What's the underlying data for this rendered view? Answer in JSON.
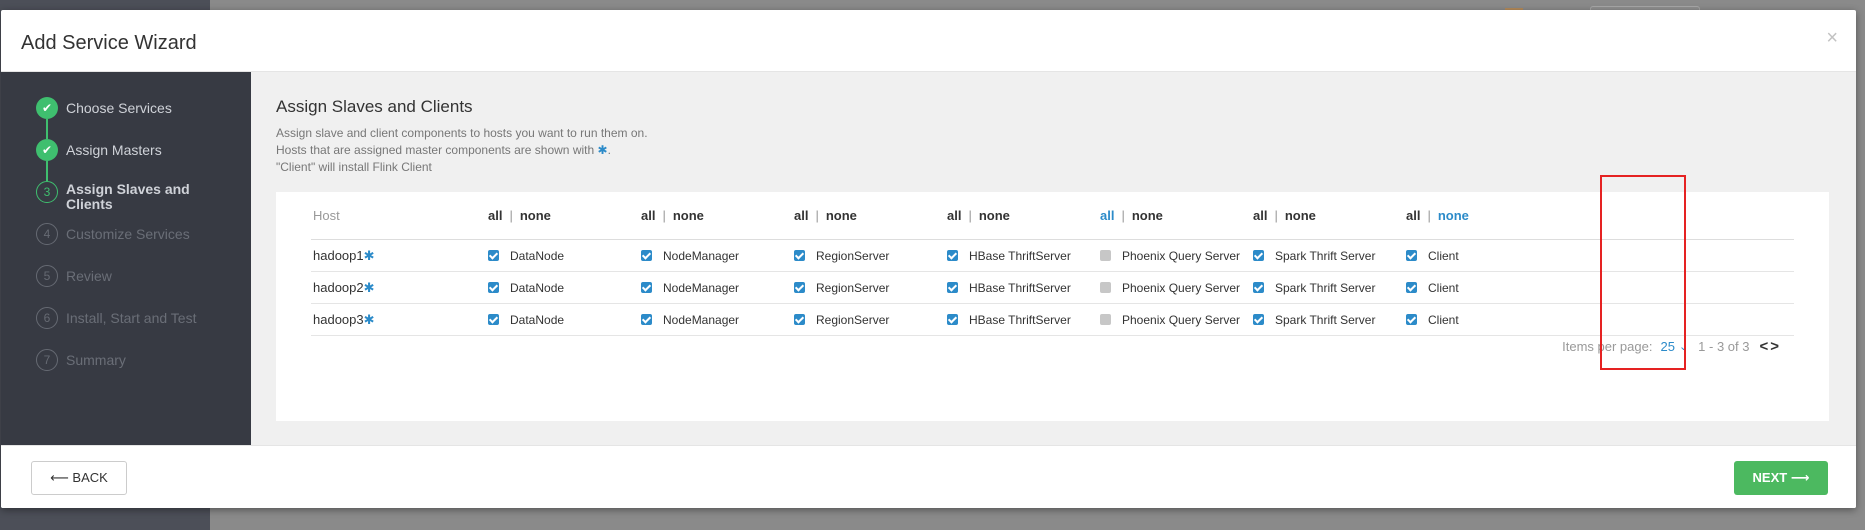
{
  "modal": {
    "title": "Add Service Wizard",
    "close_glyph": "×"
  },
  "steps": [
    {
      "icon": "✔",
      "label": "Choose Services",
      "state": "done"
    },
    {
      "icon": "✔",
      "label": "Assign Masters",
      "state": "done"
    },
    {
      "icon": "3",
      "label": "Assign Slaves and Clients",
      "state": "current"
    },
    {
      "icon": "4",
      "label": "Customize Services",
      "state": "todo"
    },
    {
      "icon": "5",
      "label": "Review",
      "state": "todo"
    },
    {
      "icon": "6",
      "label": "Install, Start and Test",
      "state": "todo"
    },
    {
      "icon": "7",
      "label": "Summary",
      "state": "todo"
    }
  ],
  "content": {
    "title": "Assign Slaves and Clients",
    "desc_line1": "Assign slave and client components to hosts you want to run them on.",
    "desc_line2_a": "Hosts that are assigned master components are shown with",
    "desc_line2_b": ".",
    "desc_line3": "\"Client\" will install Flink Client",
    "asterisk": "✱"
  },
  "table": {
    "host_header": "Host",
    "all_label": "all",
    "none_label": "none",
    "sep": "|",
    "columns": [
      {
        "name": "DataNode",
        "active": ""
      },
      {
        "name": "NodeManager",
        "active": ""
      },
      {
        "name": "RegionServer",
        "active": ""
      },
      {
        "name": "HBase ThriftServer",
        "active": ""
      },
      {
        "name": "Phoenix Query Server",
        "active": "all"
      },
      {
        "name": "Spark Thrift Server",
        "active": ""
      },
      {
        "name": "Client",
        "active": "none"
      }
    ],
    "rows": [
      {
        "host": "hadoop1",
        "checked": [
          true,
          true,
          true,
          true,
          false,
          true,
          true
        ]
      },
      {
        "host": "hadoop2",
        "checked": [
          true,
          true,
          true,
          true,
          false,
          true,
          true
        ]
      },
      {
        "host": "hadoop3",
        "checked": [
          true,
          true,
          true,
          true,
          false,
          true,
          true
        ]
      }
    ]
  },
  "pager": {
    "items_per_page_label": "Items per page:",
    "items_per_page_value": "25",
    "chevron": "⌄",
    "range": "1 - 3 of 3",
    "prev": "<",
    "next": ">"
  },
  "footer": {
    "back_label": "⟵ BACK",
    "next_label": "NEXT ⟶"
  },
  "colors": {
    "accent": "#2c8bc9",
    "success": "#3fbf6f",
    "next_button": "#4cb960",
    "highlight": "#e52222"
  }
}
